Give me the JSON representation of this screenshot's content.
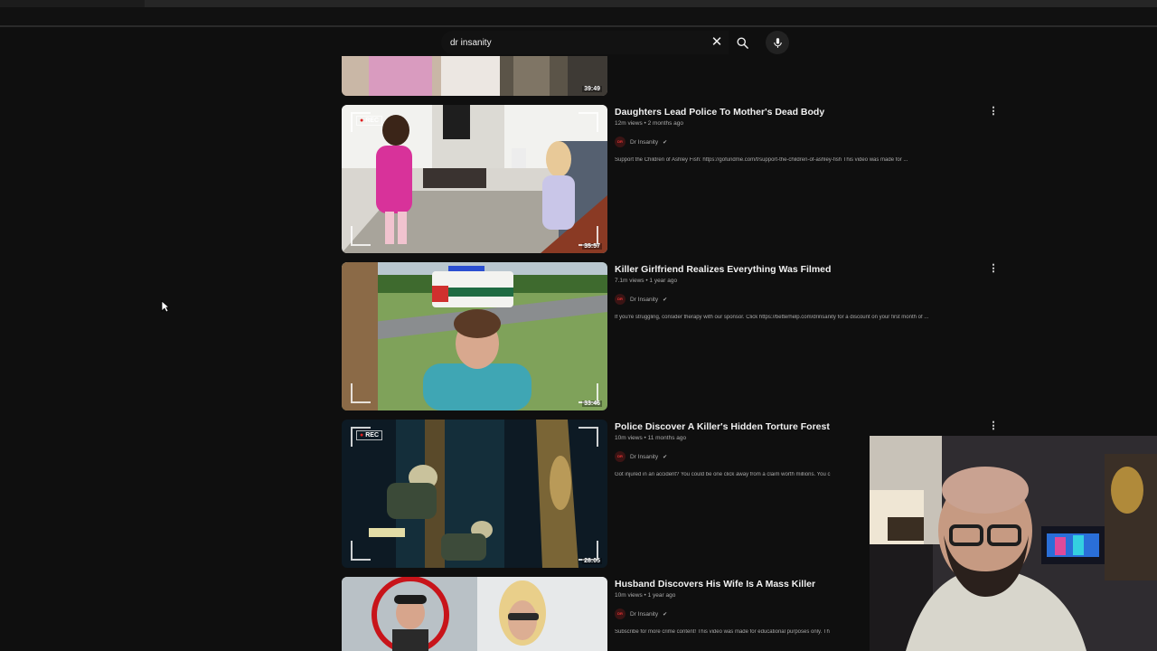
{
  "search": {
    "query": "dr insanity",
    "clear_icon": "close-icon",
    "search_icon": "search-icon",
    "mic_icon": "microphone-icon"
  },
  "partial_video": {
    "duration": "39:49"
  },
  "videos": [
    {
      "title": "Daughters Lead Police To Mother's Dead Body",
      "meta": "12m views • 2 months ago",
      "channel": "Dr Insanity",
      "description": "Support the Children of Ashley Fish: https://gofundme.com/f/support-the-children-of-ashley-fish This video was made for ...",
      "duration": "35:57",
      "rec_label": "REC"
    },
    {
      "title": "Killer Girlfriend Realizes Everything Was Filmed",
      "meta": "7.1m views • 1 year ago",
      "channel": "Dr Insanity",
      "description": "If you're struggling, consider therapy with our sponsor. Click https://betterhelp.com/drinsanity for a discount on your first month of ...",
      "duration": "33:46",
      "rec_label": ""
    },
    {
      "title": "Police Discover A Killer's Hidden Torture Forest",
      "meta": "10m views • 11 months ago",
      "channel": "Dr Insanity",
      "description": "Got injured in an accident? You could be one click away from a claim worth millions. You c",
      "duration": "28:05",
      "rec_label": "REC"
    },
    {
      "title": "Husband Discovers His Wife Is A Mass Killer",
      "meta": "10m views • 1 year ago",
      "channel": "Dr Insanity",
      "description": "Subscribe for more crime content! This video was made for educational purposes only. Th",
      "duration": "",
      "rec_label": ""
    }
  ],
  "colors": {
    "background": "#0f0f0f",
    "rec_dot": "#e02020",
    "text_primary": "#f1f1f1",
    "text_secondary": "#aaaaaa"
  }
}
